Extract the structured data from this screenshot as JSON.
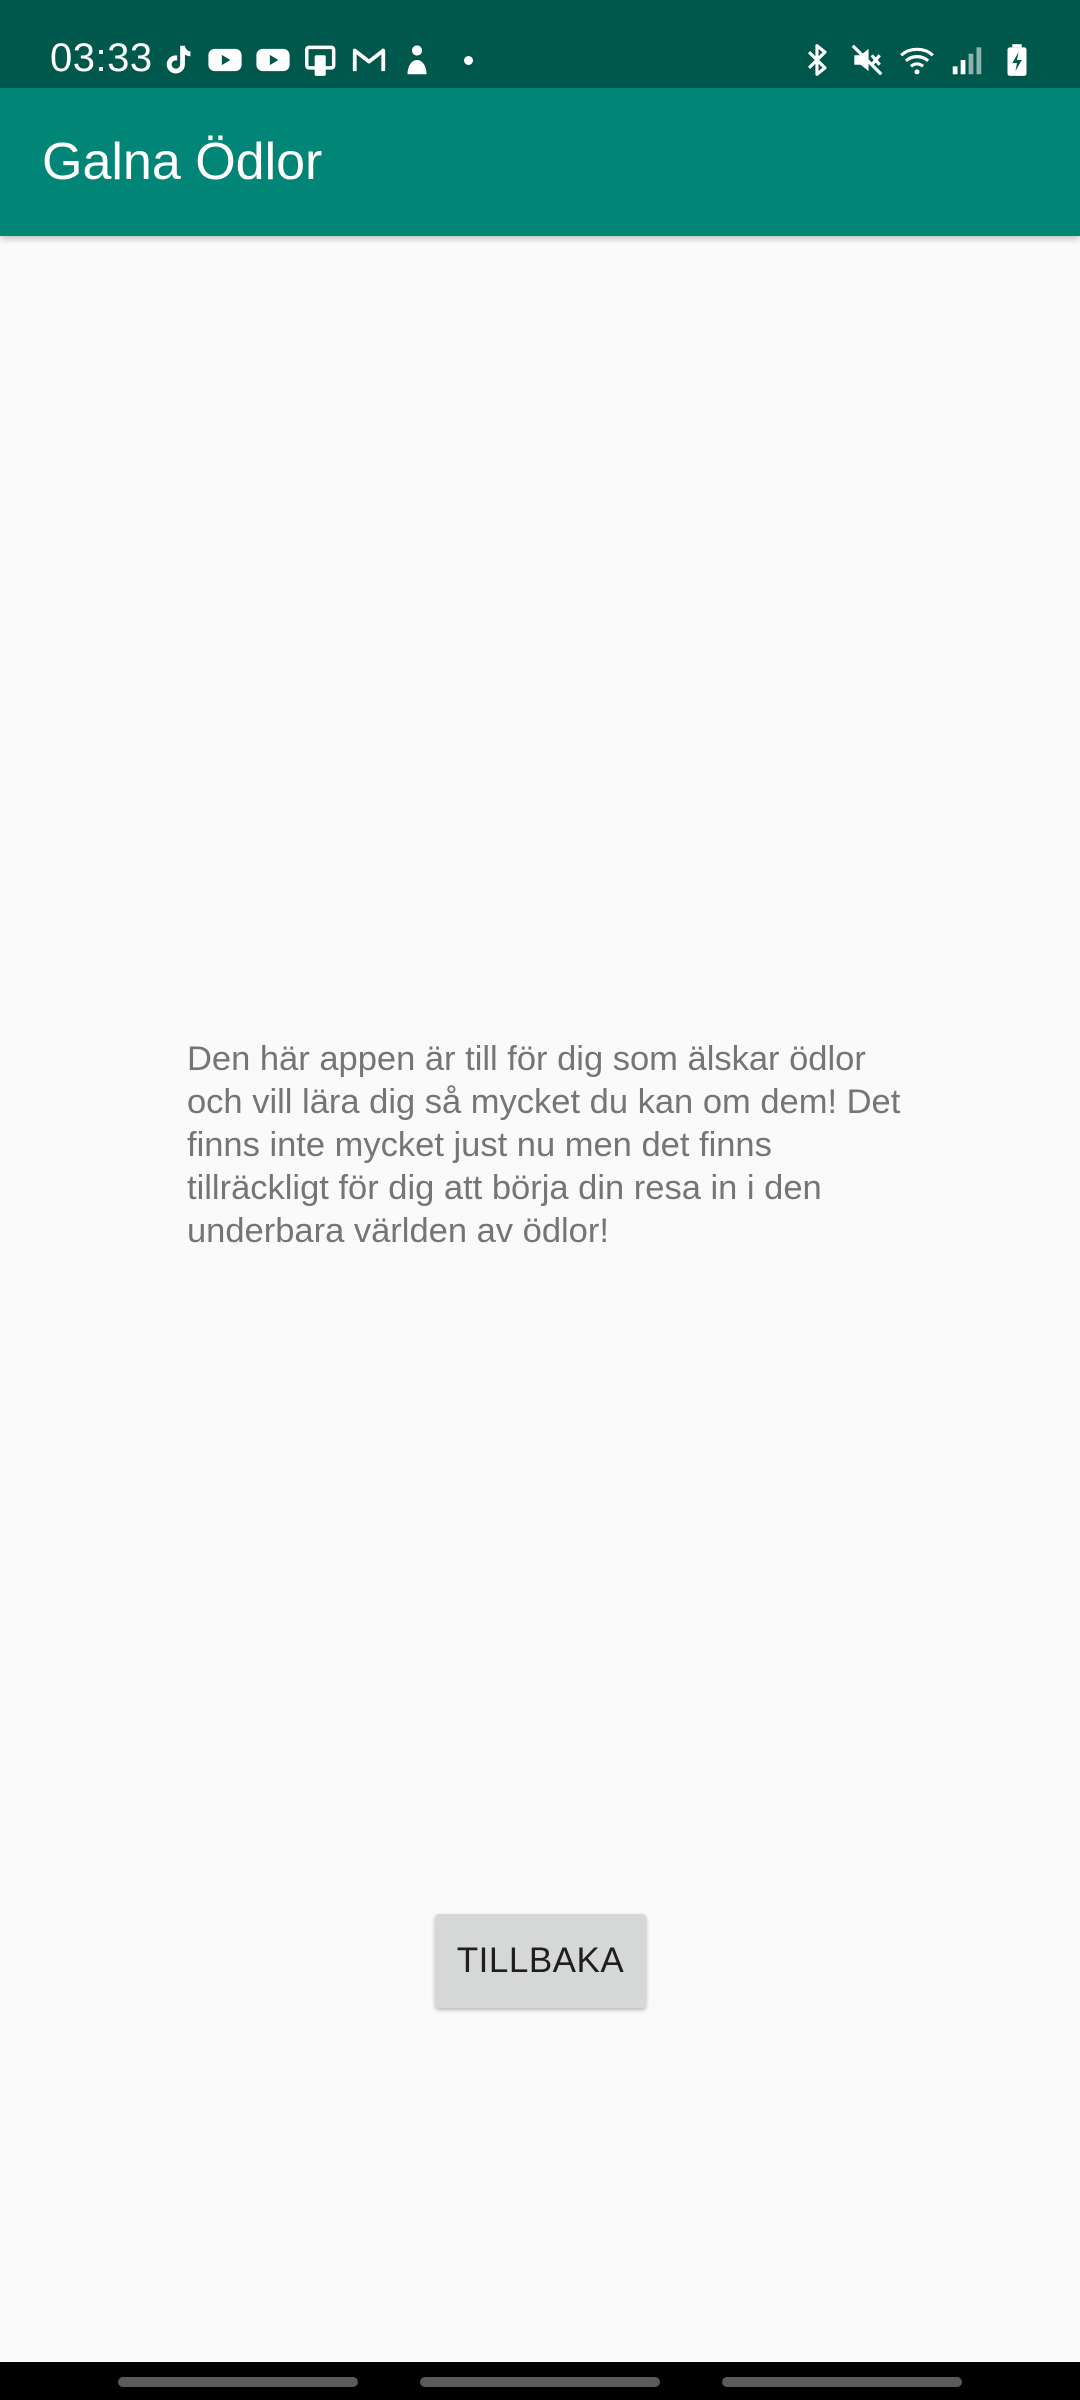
{
  "status_bar": {
    "time": "03:33",
    "background_color": "#00574b",
    "left_icons": [
      "tiktok-icon",
      "youtube-icon",
      "youtube-icon",
      "phone-link-icon",
      "gmail-icon",
      "person-icon",
      "notification-dot-icon"
    ],
    "right_icons": [
      "bluetooth-icon",
      "mute-icon",
      "wifi-icon",
      "signal-icon",
      "battery-charging-icon"
    ]
  },
  "app_bar": {
    "title": "Galna Ödlor",
    "background_color": "#008577"
  },
  "main": {
    "info_text": "Den här appen är till för dig som älskar ödlor och vill lära dig så mycket du kan om dem! Det finns inte mycket just nu men det finns tillräckligt för dig att börja din resa in i den underbara världen av ödlor!",
    "back_button_label": "TILLBAKA"
  },
  "nav_bar": {
    "items": [
      "recents-pill",
      "home-pill",
      "back-pill"
    ]
  }
}
